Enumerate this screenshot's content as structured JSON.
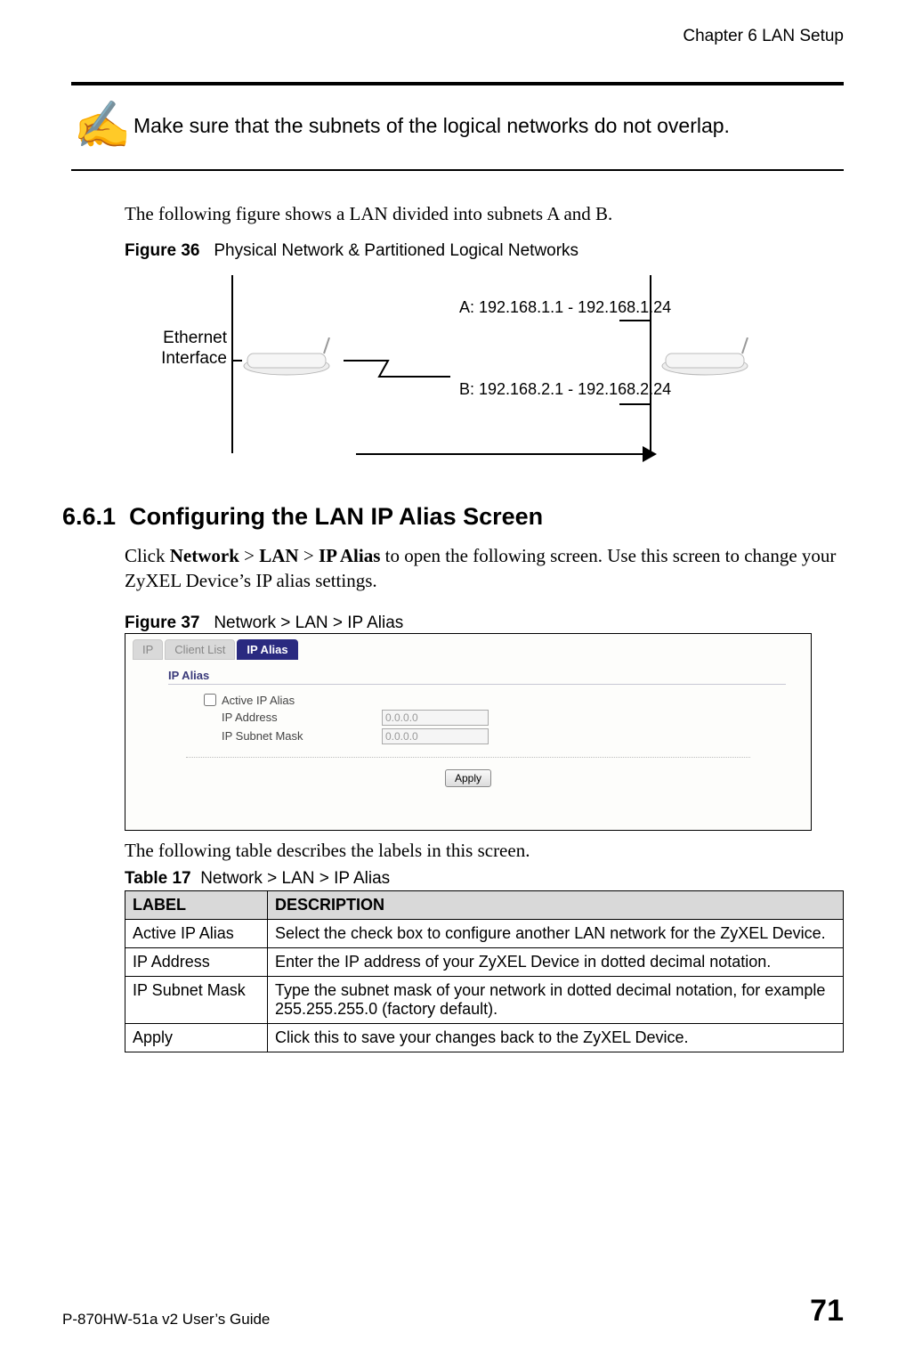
{
  "header": {
    "chapter": "Chapter 6 LAN Setup"
  },
  "note": {
    "icon_char": "✍",
    "text": "Make sure that the subnets of the logical networks do not overlap."
  },
  "intro_text": "The following figure shows a LAN divided into subnets A and B.",
  "figure36": {
    "label_prefix": "Figure 36",
    "title": "Physical Network & Partitioned Logical Networks",
    "ethernet_label_line1": "Ethernet",
    "ethernet_label_line2": "Interface",
    "range_a": "A: 192.168.1.1 - 192.168.1.24",
    "range_b": "B: 192.168.2.1 - 192.168.2.24"
  },
  "section": {
    "number": "6.6.1",
    "title": "Configuring the LAN IP Alias Screen"
  },
  "instructions": {
    "pre": "Click ",
    "b1": "Network",
    "sep1": " > ",
    "b2": "LAN",
    "sep2": " > ",
    "b3": "IP Alias",
    "post": " to open the following screen. Use this screen to change your ZyXEL Device’s IP alias settings."
  },
  "figure37": {
    "label_prefix": "Figure 37",
    "title": "Network > LAN > IP Alias",
    "tabs": {
      "ip": "IP",
      "client_list": "Client List",
      "ip_alias": "IP Alias"
    },
    "panel_title": "IP Alias",
    "checkbox_label": "Active IP Alias",
    "row1_label": "IP Address",
    "row1_value": "0.0.0.0",
    "row2_label": "IP Subnet Mask",
    "row2_value": "0.0.0.0",
    "apply": "Apply"
  },
  "after_fig37_text": "The following table describes the labels in this screen.",
  "table17": {
    "caption_prefix": "Table 17",
    "caption_title": "Network > LAN > IP Alias",
    "headers": {
      "label": "LABEL",
      "desc": "DESCRIPTION"
    },
    "rows": [
      {
        "label": "Active IP Alias",
        "desc": "Select the check box to configure another LAN network for the ZyXEL Device."
      },
      {
        "label": "IP Address",
        "desc": "Enter the IP address of your ZyXEL Device in dotted decimal notation."
      },
      {
        "label": "IP Subnet Mask",
        "desc": "Type the subnet mask of your network in dotted decimal notation, for example 255.255.255.0 (factory default)."
      },
      {
        "label": "Apply",
        "desc": "Click this to save your changes back to the ZyXEL Device."
      }
    ]
  },
  "footer": {
    "guide": "P-870HW-51a v2 User’s Guide",
    "page": "71"
  }
}
